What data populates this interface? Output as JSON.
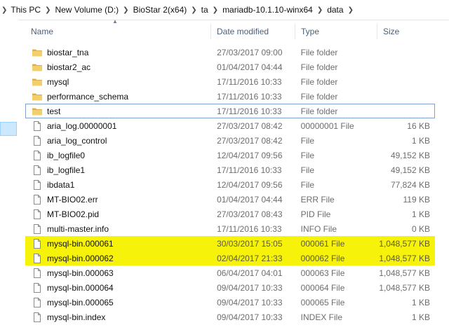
{
  "address": {
    "crumbs": [
      "This PC",
      "New Volume (D:)",
      "BioStar 2(x64)",
      "ta",
      "mariadb-10.1.10-winx64",
      "data"
    ]
  },
  "columns": {
    "name": "Name",
    "date": "Date modified",
    "type": "Type",
    "size": "Size"
  },
  "files": [
    {
      "name": "biostar_tna",
      "date": "27/03/2017 09:00",
      "type": "File folder",
      "size": "",
      "kind": "folder"
    },
    {
      "name": "biostar2_ac",
      "date": "01/04/2017 04:44",
      "type": "File folder",
      "size": "",
      "kind": "folder"
    },
    {
      "name": "mysql",
      "date": "17/11/2016 10:33",
      "type": "File folder",
      "size": "",
      "kind": "folder"
    },
    {
      "name": "performance_schema",
      "date": "17/11/2016 10:33",
      "type": "File folder",
      "size": "",
      "kind": "folder"
    },
    {
      "name": "test",
      "date": "17/11/2016 10:33",
      "type": "File folder",
      "size": "",
      "kind": "folder"
    },
    {
      "name": "aria_log.00000001",
      "date": "27/03/2017 08:42",
      "type": "00000001 File",
      "size": "16 KB",
      "kind": "file"
    },
    {
      "name": "aria_log_control",
      "date": "27/03/2017 08:42",
      "type": "File",
      "size": "1 KB",
      "kind": "file"
    },
    {
      "name": "ib_logfile0",
      "date": "12/04/2017 09:56",
      "type": "File",
      "size": "49,152 KB",
      "kind": "file"
    },
    {
      "name": "ib_logfile1",
      "date": "17/11/2016 10:33",
      "type": "File",
      "size": "49,152 KB",
      "kind": "file"
    },
    {
      "name": "ibdata1",
      "date": "12/04/2017 09:56",
      "type": "File",
      "size": "77,824 KB",
      "kind": "file"
    },
    {
      "name": "MT-BIO02.err",
      "date": "01/04/2017 04:44",
      "type": "ERR File",
      "size": "119 KB",
      "kind": "file"
    },
    {
      "name": "MT-BIO02.pid",
      "date": "27/03/2017 08:43",
      "type": "PID File",
      "size": "1 KB",
      "kind": "file"
    },
    {
      "name": "multi-master.info",
      "date": "17/11/2016 10:33",
      "type": "INFO File",
      "size": "0 KB",
      "kind": "file"
    },
    {
      "name": "mysql-bin.000061",
      "date": "30/03/2017 15:05",
      "type": "000061 File",
      "size": "1,048,577 KB",
      "kind": "file"
    },
    {
      "name": "mysql-bin.000062",
      "date": "02/04/2017 21:33",
      "type": "000062 File",
      "size": "1,048,577 KB",
      "kind": "file"
    },
    {
      "name": "mysql-bin.000063",
      "date": "06/04/2017 04:01",
      "type": "000063 File",
      "size": "1,048,577 KB",
      "kind": "file"
    },
    {
      "name": "mysql-bin.000064",
      "date": "09/04/2017 10:33",
      "type": "000064 File",
      "size": "1,048,577 KB",
      "kind": "file"
    },
    {
      "name": "mysql-bin.000065",
      "date": "09/04/2017 10:33",
      "type": "000065 File",
      "size": "1 KB",
      "kind": "file"
    },
    {
      "name": "mysql-bin.index",
      "date": "09/04/2017 10:33",
      "type": "INDEX File",
      "size": "1 KB",
      "kind": "file"
    }
  ],
  "focused_item": "test",
  "highlighted_items": [
    "mysql-bin.000061",
    "mysql-bin.000062"
  ],
  "colors": {
    "highlight": "#f7f20a",
    "selection_border": "#7da2ce",
    "folder": "#e8b84a"
  },
  "icons": {
    "folder": "folder-icon",
    "file": "file-icon",
    "sort": "sort-ascending-icon",
    "chevron": "chevron-right-icon"
  }
}
